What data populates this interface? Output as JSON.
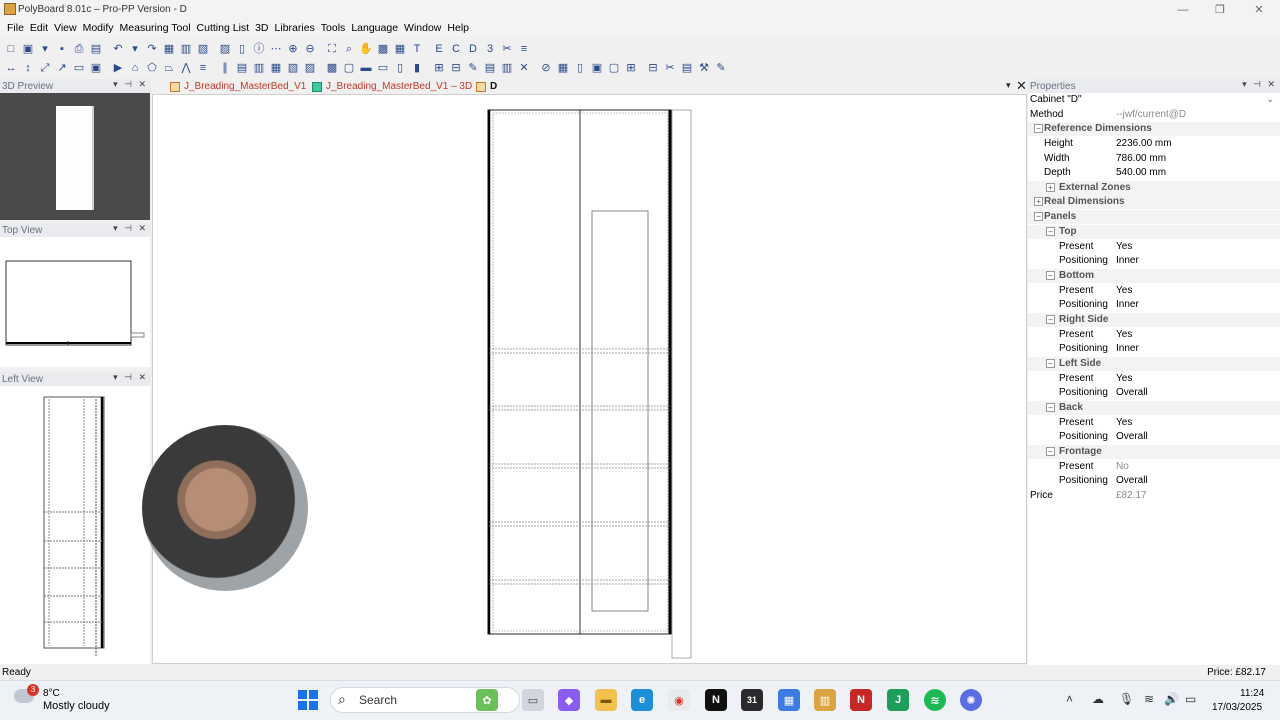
{
  "window": {
    "title": "PolyBoard 8.01c – Pro-PP Version - D",
    "controls": [
      "—",
      "❐",
      "✕"
    ]
  },
  "menu": [
    "File",
    "Edit",
    "View",
    "Modify",
    "Measuring Tool",
    "Cutting List",
    "3D",
    "Libraries",
    "Tools",
    "Language",
    "Window",
    "Help"
  ],
  "toolbar1_icons": [
    "new-file-icon",
    "open-icon",
    "open-dropdown-icon",
    "save-icon",
    "print-icon",
    "print-preview-icon",
    "undo-icon",
    "undo-dropdown-icon",
    "redo-icon",
    "cabinet-icon",
    "cabinet-3d-icon",
    "cabinet-front-icon",
    "cabinet-open-icon",
    "door-icon",
    "info-icon",
    "options-icon",
    "zoom-in-icon",
    "zoom-out-icon",
    "zoom-fit-icon",
    "zoom-window-icon",
    "pan-hand-icon",
    "display-icon",
    "grid-icon",
    "export-txt-icon",
    "export-erp-icon",
    "export-csv-icon",
    "export-dxf-icon",
    "export-3ds-icon",
    "machining-icon",
    "optimise-icon"
  ],
  "toolbar1_glyphs": [
    "□",
    "▣",
    "▾",
    "▪",
    "⎙",
    "▤",
    "↶",
    "▾",
    "↷",
    "▦",
    "▥",
    "▧",
    "▨",
    "▯",
    "ⓘ",
    "⋯",
    "⊕",
    "⊖",
    "⛶",
    "⌕",
    "✋",
    "▩",
    "▦",
    "T",
    "E",
    "C",
    "D",
    "3",
    "✂",
    "≡"
  ],
  "toolbar2_glyphs": [
    "↔",
    "↕",
    "⤢",
    "↗",
    "▭",
    "▣",
    "▶",
    "⌂",
    "⬠",
    "⏢",
    "⋀",
    "≡",
    "∥",
    "▤",
    "▥",
    "▦",
    "▧",
    "▨",
    "▩",
    "▢",
    "▬",
    "▭",
    "▯",
    "▮",
    "⊞",
    "⊟",
    "✎",
    "▤",
    "▥",
    "✕",
    "⊘",
    "▦",
    "▯",
    "▣",
    "▢",
    "⊞",
    "⊟",
    "✂",
    "▤",
    "⚒",
    "✎"
  ],
  "panels": {
    "preview": "3D Preview",
    "top": "Top View",
    "left": "Left View",
    "controls": "▾ ⊣ ✕"
  },
  "tabs": [
    {
      "label": "J_Breading_MasterBed_V1",
      "icon": "cabinet-file-icon"
    },
    {
      "label": "J_Breading_MasterBed_V1 – 3D",
      "icon": "3d-view-icon"
    },
    {
      "label": "D",
      "icon": "cabinet-file-icon"
    }
  ],
  "tab_controls": {
    "menu": "▾",
    "close": "✕"
  },
  "properties": {
    "header": "Properties",
    "selected": "Cabinet \"D\"",
    "method_label": "Method",
    "method_value": "--jwf/current@D",
    "reference_dimensions": "Reference Dimensions",
    "height_label": "Height",
    "height_value": "2236.00 mm",
    "width_label": "Width",
    "width_value": "786.00 mm",
    "depth_label": "Depth",
    "depth_value": "540.00 mm",
    "external_zones": "External Zones",
    "real_dimensions": "Real Dimensions",
    "panels": "Panels",
    "present_label": "Present",
    "positioning_label": "Positioning",
    "top": {
      "name": "Top",
      "present": "Yes",
      "positioning": "Inner"
    },
    "bottom": {
      "name": "Bottom",
      "present": "Yes",
      "positioning": "Inner"
    },
    "right_side": {
      "name": "Right Side",
      "present": "Yes",
      "positioning": "Inner"
    },
    "left_side": {
      "name": "Left Side",
      "present": "Yes",
      "positioning": "Overall"
    },
    "back": {
      "name": "Back",
      "present": "Yes",
      "positioning": "Overall"
    },
    "frontage": {
      "name": "Frontage",
      "present": "No",
      "positioning": "Overall"
    },
    "price_label": "Price",
    "price_value": "£82.17"
  },
  "status": {
    "ready": "Ready",
    "price": "Price: £82.17"
  },
  "taskbar": {
    "weather_badge": "3",
    "weather_temp": "8°C",
    "weather_desc": "Mostly cloudy",
    "search": "Search",
    "time": "11:24",
    "date": "17/03/2025"
  },
  "colors": {
    "accent": "#1a73e8",
    "tab_text": "#c0392b",
    "preview_bg": "#4a4a4a"
  }
}
